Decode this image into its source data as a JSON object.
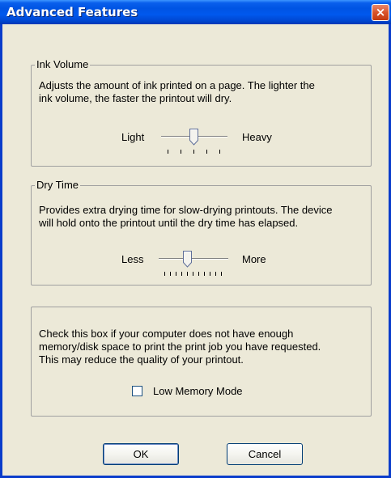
{
  "window": {
    "title": "Advanced Features",
    "close_glyph": "×"
  },
  "ink_volume": {
    "legend": "Ink Volume",
    "description_line1": "Adjusts the amount of ink printed on a page. The lighter the",
    "description_line2": "ink volume, the faster the printout will dry.",
    "min_label": "Light",
    "max_label": "Heavy",
    "tick_count": 5,
    "position": 2
  },
  "dry_time": {
    "legend": "Dry Time",
    "description_line1": "Provides extra drying time for slow-drying printouts. The device",
    "description_line2": "will hold onto the printout until the dry time has elapsed.",
    "min_label": "Less",
    "max_label": "More",
    "tick_count": 11,
    "position": 4
  },
  "memory": {
    "description_line1": "Check this box if your computer does not have enough",
    "description_line2": "memory/disk space to print the print job you have requested.",
    "description_line3": "This may reduce the quality of your printout.",
    "checkbox_label": "Low Memory Mode",
    "checked": false
  },
  "buttons": {
    "ok": "OK",
    "cancel": "Cancel"
  }
}
